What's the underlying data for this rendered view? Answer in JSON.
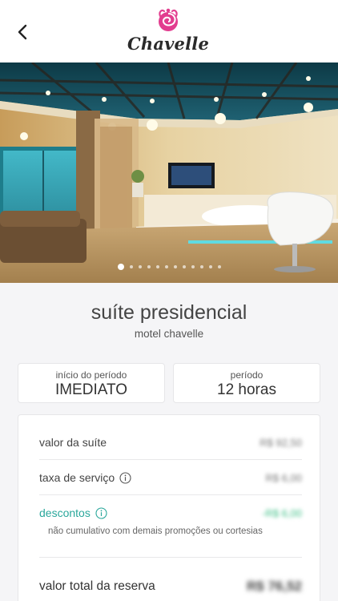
{
  "header": {
    "logo_text": "Chavelle",
    "back_icon": "chevron-left-icon"
  },
  "gallery": {
    "total_images": 12,
    "active_index": 0
  },
  "room": {
    "title": "suíte presidencial",
    "subtitle": "motel chavelle"
  },
  "period": {
    "start_label": "início do período",
    "start_value": "IMEDIATO",
    "duration_label": "período",
    "duration_value": "12 horas"
  },
  "summary": {
    "suite_value_label": "valor da suíte",
    "suite_value": "R$ 92,50",
    "service_fee_label": "taxa de serviço",
    "service_fee_value": "R$ 6,00",
    "discounts_label": "descontos",
    "discounts_value": "-R$ 6,00",
    "discounts_note": "não cumulativo com demais promoções ou cortesias",
    "total_label": "valor total da reserva",
    "total_value": "R$ 76,52"
  },
  "colors": {
    "accent": "#2aa79b",
    "discount_value": "#3cbf85",
    "logo_pink": "#e23d8f"
  }
}
